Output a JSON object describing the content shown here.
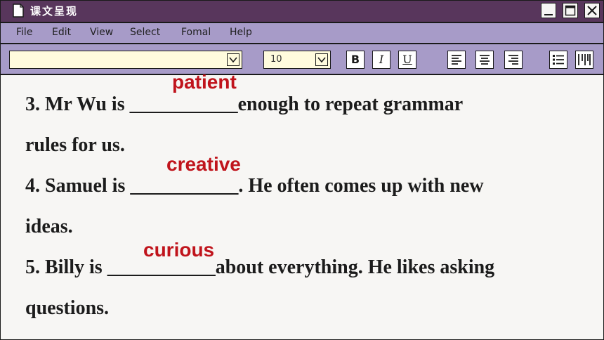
{
  "window": {
    "title": "课文呈现"
  },
  "menu": [
    "File",
    "Edit",
    "View",
    "Select",
    "Fomal",
    "Help"
  ],
  "toolbar": {
    "font_name": "",
    "font_size": "10",
    "bold_label": "B",
    "italic_label": "I",
    "underline_label": "U"
  },
  "document": {
    "answers": [
      "patient",
      "creative",
      "curious"
    ],
    "lines": [
      "3. Mr Wu is ___________enough to repeat grammar",
      "rules for us.",
      "4. Samuel is ___________. He often comes up with new",
      "ideas.",
      "5. Billy is ___________about everything. He likes asking",
      "questions."
    ]
  },
  "colors": {
    "titlebar": "#58365c",
    "menubar": "#a79bc8",
    "answer": "#c0141c",
    "input_bg": "#fffbdd",
    "document_bg": "#f7f6f4"
  },
  "icons": [
    "document-icon",
    "minimize-icon",
    "maximize-icon",
    "close-icon",
    "chevron-down-icon",
    "align-left-icon",
    "align-center-icon",
    "align-right-icon",
    "bullet-list-icon",
    "columns-icon"
  ]
}
